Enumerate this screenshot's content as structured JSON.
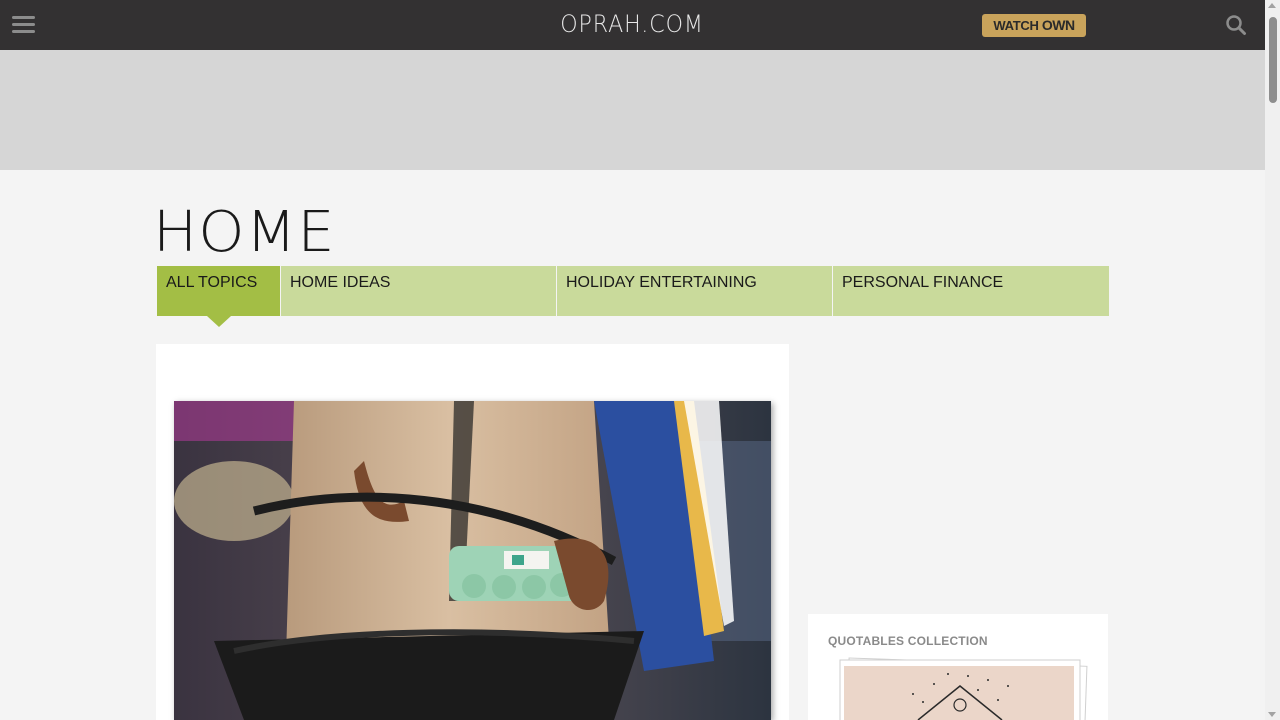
{
  "header": {
    "logo": "OPRAH.COM",
    "watch_label": "WATCH",
    "watch_brand": "OWN"
  },
  "page": {
    "title": "HOME"
  },
  "tabs": [
    {
      "label": "ALL TOPICS",
      "active": true
    },
    {
      "label": "HOME IDEAS",
      "active": false
    },
    {
      "label": "HOLIDAY ENTERTAINING",
      "active": false
    },
    {
      "label": "PERSONAL FINANCE",
      "active": false
    }
  ],
  "sidebar": {
    "collection_title": "QUOTABLES COLLECTION"
  },
  "colors": {
    "header_bg": "#333132",
    "accent_gold": "#c9a35b",
    "tab_bg": "#c9da9b",
    "tab_active": "#a3be45"
  },
  "icons": {
    "menu": "hamburger-menu-icon",
    "search": "search-icon"
  }
}
